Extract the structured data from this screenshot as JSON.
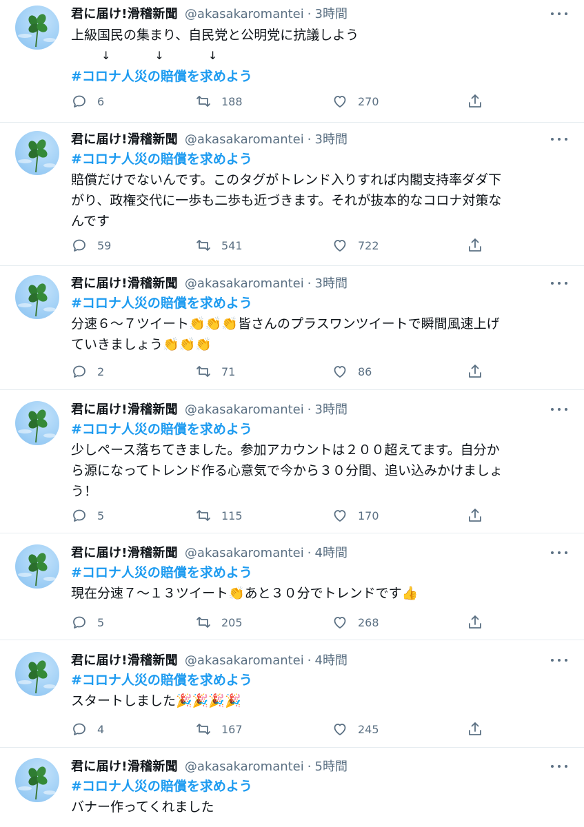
{
  "tweets": [
    {
      "name": "君に届け!滑稽新聞",
      "handle": "@akasakaromantei",
      "separator": "·",
      "time": "3時間",
      "lines": [
        {
          "text": "上級国民の集まり、自民党と公明党に抗議しよう",
          "style": "text"
        },
        {
          "text": "↓　　　　↓　　　　↓",
          "style": "arrows"
        },
        {
          "text": "#コロナ人災の賠償を求めよう",
          "style": "tag"
        }
      ],
      "replies": "6",
      "retweets": "188",
      "likes": "270"
    },
    {
      "name": "君に届け!滑稽新聞",
      "handle": "@akasakaromantei",
      "separator": "·",
      "time": "3時間",
      "lines": [
        {
          "text": "#コロナ人災の賠償を求めよう",
          "style": "tag"
        },
        {
          "text": "賠償だけでないんです。このタグがトレンド入りすれば内閣支持率ダダ下",
          "style": "text"
        },
        {
          "text": "がり、政権交代に一歩も二歩も近づきます。それが抜本的なコロナ対策な",
          "style": "text"
        },
        {
          "text": "んです",
          "style": "text"
        }
      ],
      "replies": "59",
      "retweets": "541",
      "likes": "722"
    },
    {
      "name": "君に届け!滑稽新聞",
      "handle": "@akasakaromantei",
      "separator": "·",
      "time": "3時間",
      "lines": [
        {
          "text": "#コロナ人災の賠償を求めよう",
          "style": "tag"
        },
        {
          "text": "分速６～７ツイート👏👏👏皆さんのプラスワンツイートで瞬間風速上げ",
          "style": "text"
        },
        {
          "text": "ていきましょう👏👏👏",
          "style": "text"
        }
      ],
      "replies": "2",
      "retweets": "71",
      "likes": "86"
    },
    {
      "name": "君に届け!滑稽新聞",
      "handle": "@akasakaromantei",
      "separator": "·",
      "time": "3時間",
      "lines": [
        {
          "text": "#コロナ人災の賠償を求めよう",
          "style": "tag"
        },
        {
          "text": "少しペース落ちてきました。参加アカウントは２００超えてます。自分か",
          "style": "text"
        },
        {
          "text": "ら源になってトレンド作る心意気で今から３０分間、追い込みかけましょ",
          "style": "text"
        },
        {
          "text": "う！",
          "style": "text"
        }
      ],
      "replies": "5",
      "retweets": "115",
      "likes": "170"
    },
    {
      "name": "君に届け!滑稽新聞",
      "handle": "@akasakaromantei",
      "separator": "·",
      "time": "4時間",
      "lines": [
        {
          "text": "#コロナ人災の賠償を求めよう",
          "style": "tag"
        },
        {
          "text": "現在分速７～１３ツイート👏あと３０分でトレンドです👍",
          "style": "text"
        }
      ],
      "replies": "5",
      "retweets": "205",
      "likes": "268"
    },
    {
      "name": "君に届け!滑稽新聞",
      "handle": "@akasakaromantei",
      "separator": "·",
      "time": "4時間",
      "lines": [
        {
          "text": "#コロナ人災の賠償を求めよう",
          "style": "tag"
        },
        {
          "text": "スタートしました🎉🎉🎉🎉",
          "style": "text"
        }
      ],
      "replies": "4",
      "retweets": "167",
      "likes": "245"
    },
    {
      "name": "君に届け!滑稽新聞",
      "handle": "@akasakaromantei",
      "separator": "·",
      "time": "5時間",
      "lines": [
        {
          "text": "#コロナ人災の賠償を求めよう",
          "style": "tag"
        },
        {
          "text": "バナー作ってくれました",
          "style": "text"
        }
      ]
    }
  ],
  "colors": {
    "hashtag": "#1d9bf0",
    "secondary_text": "#5b7083",
    "divider": "#e6ecf0"
  },
  "icons": {
    "reply": "reply-icon",
    "retweet": "retweet-icon",
    "like": "like-icon",
    "share": "share-icon",
    "more": "more-icon",
    "avatar": "clover-avatar"
  }
}
